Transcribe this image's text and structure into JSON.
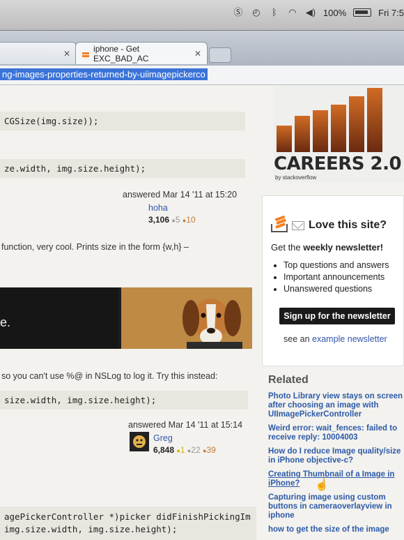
{
  "menubar": {
    "battery": "100%",
    "clock": "Fri 7:5",
    "icons": [
      "skype-icon",
      "time-machine-icon",
      "bluetooth-icon",
      "wifi-icon",
      "volume-icon",
      "battery-icon"
    ]
  },
  "tabs": [
    {
      "title": "",
      "active": false
    },
    {
      "title": "iphone - Get EXC_BAD_AC",
      "active": true
    }
  ],
  "address": {
    "url": "ng-images-properties-returned-by-uiimagepickerco"
  },
  "code_blocks": [
    "CGSize(img.size));",
    "ze.width, img.size.height);",
    "size.width, img.size.height);",
    "agePickerController *)picker didFinishPickingIm\nimg.size.width, img.size.height);"
  ],
  "answers": [
    {
      "answered": "answered Mar 14 '11 at 15:20",
      "user": "hoha",
      "rep": "3,106",
      "silver": "5",
      "bronze": "10"
    },
    {
      "answered": "answered Mar 14 '11 at 15:14",
      "user": "Greg",
      "rep": "6,848",
      "gold": "1",
      "silver": "22",
      "bronze": "39"
    }
  ],
  "comment1": "function, very cool. Prints size in the form {w,h} –",
  "photo_text": "e.",
  "answer2_intro": "so you can't use  %@  in NSLog to log it. Try this instead:",
  "sidebar": {
    "careers_title": "CAREERS 2.0",
    "careers_by": "by stackoverflow",
    "newsletter_title": "Love this site?",
    "newsletter_sub_prefix": "Get the ",
    "newsletter_sub_bold": "weekly newsletter!",
    "newsletter_items": [
      "Top questions and answers",
      "Important announcements",
      "Unanswered questions"
    ],
    "signup_label": "Sign up for the newsletter",
    "example_prefix": "see an ",
    "example_link": "example newsletter",
    "related_heading": "Related",
    "related": [
      "Photo Library view stays on screen after choosing an image with UIImagePickerController",
      "Weird error: wait_fences: failed to receive reply: 10004003",
      "How do I reduce Image quality/size in iPhone objective-c?",
      "Creating Thumbnail of a Image in iPhone?",
      "Capturing image using custom buttons in cameraoverlayview in iphone",
      "how to get the size of the image"
    ]
  }
}
